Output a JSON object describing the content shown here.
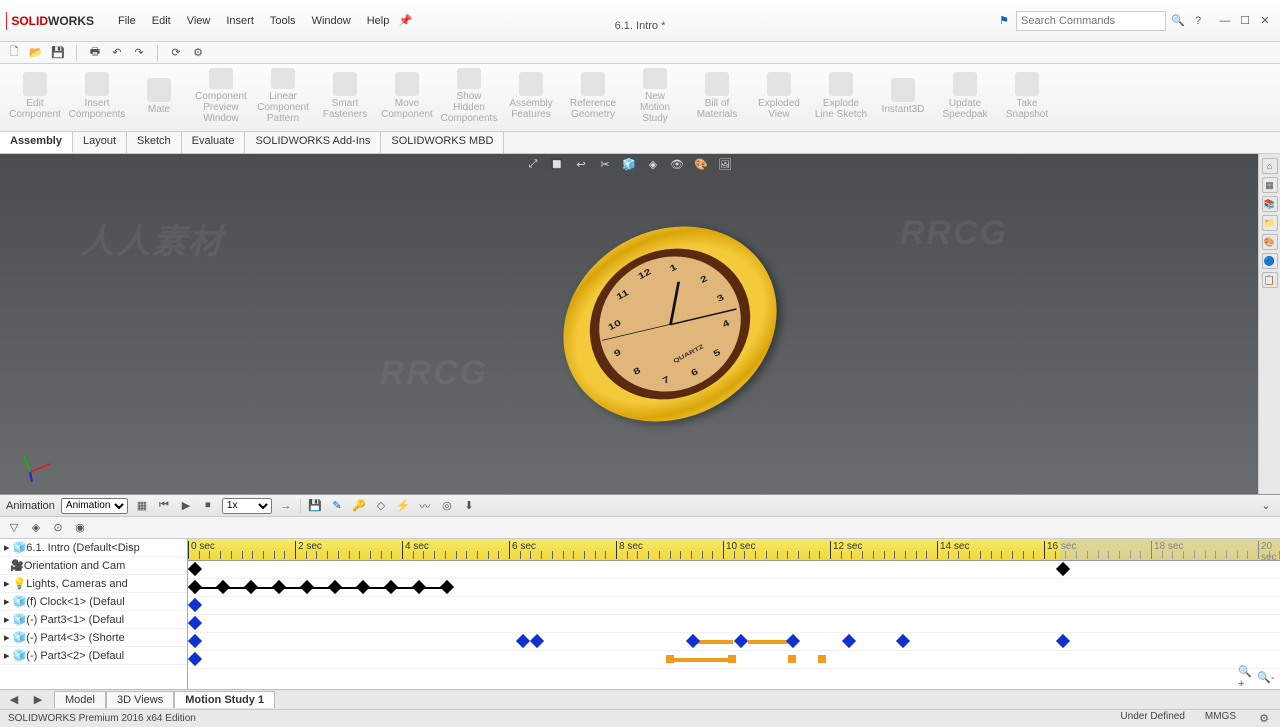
{
  "app": {
    "brand1": "SOLID",
    "brand2": "WORKS"
  },
  "menus": [
    "File",
    "Edit",
    "View",
    "Insert",
    "Tools",
    "Window",
    "Help"
  ],
  "doc_title": "6.1. Intro *",
  "search": {
    "placeholder": "Search Commands"
  },
  "ribbon": {
    "items": [
      {
        "l1": "Edit",
        "l2": "Component"
      },
      {
        "l1": "Insert",
        "l2": "Components"
      },
      {
        "l1": "Mate",
        "l2": ""
      },
      {
        "l1": "Component",
        "l2": "Preview Window"
      },
      {
        "l1": "Linear",
        "l2": "Component Pattern"
      },
      {
        "l1": "Smart",
        "l2": "Fasteners"
      },
      {
        "l1": "Move",
        "l2": "Component"
      },
      {
        "l1": "Show",
        "l2": "Hidden Components"
      },
      {
        "l1": "Assembly",
        "l2": "Features"
      },
      {
        "l1": "Reference",
        "l2": "Geometry"
      },
      {
        "l1": "New",
        "l2": "Motion Study"
      },
      {
        "l1": "Bill of",
        "l2": "Materials"
      },
      {
        "l1": "Exploded",
        "l2": "View"
      },
      {
        "l1": "Explode",
        "l2": "Line Sketch"
      },
      {
        "l1": "Instant3D",
        "l2": ""
      },
      {
        "l1": "Update",
        "l2": "Speedpak"
      },
      {
        "l1": "Take",
        "l2": "Snapshot"
      }
    ]
  },
  "ftabs": [
    "Assembly",
    "Layout",
    "Sketch",
    "Evaluate",
    "SOLIDWORKS Add-Ins",
    "SOLIDWORKS MBD"
  ],
  "ftab_active": 0,
  "clock": {
    "brand": "QUARTZ",
    "numbers": [
      "12",
      "1",
      "2",
      "3",
      "4",
      "5",
      "6",
      "7",
      "8",
      "9",
      "10",
      "11"
    ]
  },
  "anim": {
    "label": "Animation",
    "speed": "1x",
    "tree": [
      "6.1. Intro  (Default<Disp",
      "Orientation and Cam",
      "Lights, Cameras and",
      "(f) Clock<1> (Defaul",
      "(-) Part3<1> (Defaul",
      "(-) Part4<3> (Shorte",
      "(-) Part3<2> (Defaul"
    ],
    "ticks": [
      "0 sec",
      "2 sec",
      "4 sec",
      "6 sec",
      "8 sec",
      "10 sec",
      "12 sec",
      "14 sec",
      "16 sec",
      "18 sec",
      "20 sec"
    ],
    "end_sec": 16.3
  },
  "btm_tabs": [
    "Model",
    "3D Views",
    "Motion Study 1"
  ],
  "btm_active": 2,
  "status": {
    "edition": "SOLIDWORKS Premium 2016 x64 Edition",
    "def": "Under Defined",
    "units": "MMGS"
  },
  "watermark": "RRCG",
  "wm2": "人人素材"
}
